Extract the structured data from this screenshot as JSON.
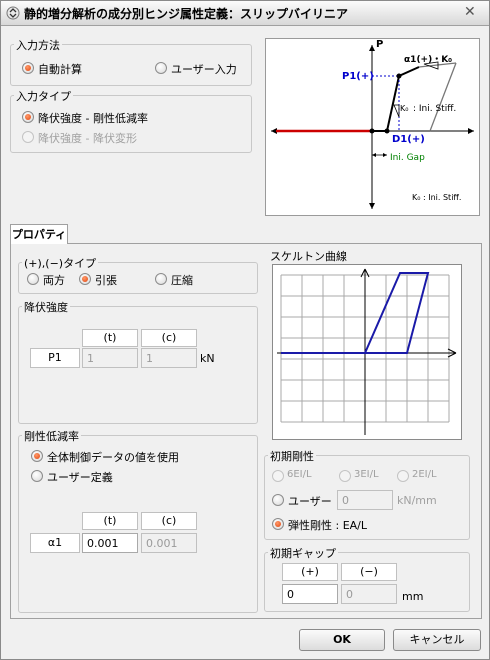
{
  "window": {
    "title": "静的増分解析の成分別ヒンジ属性定義：スリップバイリニア"
  },
  "input_method": {
    "legend": "入力方法",
    "options": [
      {
        "label": "自動計算",
        "checked": true
      },
      {
        "label": "ユーザー入力",
        "checked": false
      }
    ]
  },
  "input_type": {
    "legend": "入力タイプ",
    "options": [
      {
        "label": "降伏強度 - 剛性低減率",
        "checked": true
      },
      {
        "label": "降伏強度 - 降伏変形",
        "checked": false
      }
    ]
  },
  "diagram": {
    "p_label": "P",
    "p1_label": "P1(+)",
    "d1_label": "D1(+)",
    "alpha_label": "α1(+)・K₀",
    "k0_mark": "K₀",
    "ini_stiff_label": ": Ini. Stiff.",
    "ini_gap_label": "Ini. Gap",
    "legend_note": "K₀ : Ini. Stiff."
  },
  "tabs": {
    "properties": "プロパティ"
  },
  "direction": {
    "legend": "(+),(−)タイプ",
    "options": [
      {
        "label": "両方",
        "checked": false
      },
      {
        "label": "引張",
        "checked": true
      },
      {
        "label": "圧縮",
        "checked": false
      }
    ]
  },
  "yield_strength": {
    "legend": "降伏強度",
    "col_t": "(t)",
    "col_c": "(c)",
    "row_label": "P1",
    "value_t": "1",
    "value_c": "1",
    "unit": "kN"
  },
  "stiffness_reduction": {
    "legend": "剛性低減率",
    "options": [
      {
        "label": "全体制御データの値を使用",
        "checked": true
      },
      {
        "label": "ユーザー定義",
        "checked": false
      }
    ],
    "col_t": "(t)",
    "col_c": "(c)",
    "row_label": "α1",
    "value_t": "0.001",
    "value_c": "0.001"
  },
  "skeleton_curve": {
    "legend": "スケルトン曲線"
  },
  "initial_stiffness": {
    "legend": "初期剛性",
    "opt_6": "6EI/L",
    "opt_3": "3EI/L",
    "opt_2": "2EI/L",
    "user_label": "ユーザー",
    "user_value": "0",
    "user_unit": "kN/mm",
    "elastic_label": "弾性剛性 : EA/L"
  },
  "initial_gap": {
    "legend": "初期ギャップ",
    "col_plus": "(+)",
    "col_minus": "(−)",
    "value_plus": "0",
    "value_minus": "0",
    "unit": "mm"
  },
  "buttons": {
    "ok": "OK",
    "cancel": "キャンセル"
  },
  "colors": {
    "accent_radio": "#e0440e",
    "curve_blue": "#1a1aa8",
    "diagram_red": "#cc0000",
    "diagram_blue": "#0000cc"
  }
}
